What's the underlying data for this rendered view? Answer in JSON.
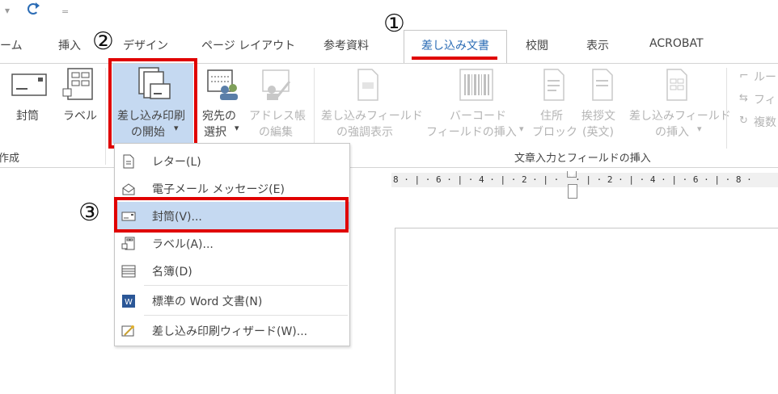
{
  "quick_access": {
    "dropdown_glyph": "▾",
    "customize_glyph": "="
  },
  "tabs": [
    {
      "label": "ホーム"
    },
    {
      "label": "挿入"
    },
    {
      "label": "デザイン"
    },
    {
      "label": "ページ レイアウト"
    },
    {
      "label": "参考資料"
    },
    {
      "label": "差し込み文書",
      "active": true
    },
    {
      "label": "校閲"
    },
    {
      "label": "表示"
    },
    {
      "label": "ACROBAT"
    }
  ],
  "ribbon": {
    "create_group": {
      "label": "作成",
      "envelope_button": "封筒",
      "label_button": "ラベル"
    },
    "start_group": {
      "start_merge_line1": "差し込み印刷",
      "start_merge_line2": "の開始",
      "select_recipients_line1": "宛先の",
      "select_recipients_line2": "選択",
      "edit_list_line1": "アドレス帳",
      "edit_list_line2": "の編集",
      "dropdown_arrow": "▾"
    },
    "fields_group": {
      "label": "文章入力とフィールドの挿入",
      "highlight_fields_line1": "差し込みフィールド",
      "highlight_fields_line2": "の強調表示",
      "barcode_line1": "バーコード",
      "barcode_line2": "フィールドの挿入",
      "address_block_line1": "住所",
      "address_block_line2": "ブロック",
      "greeting_line1": "挨拶文",
      "greeting_line2": "(英文)",
      "insert_field_line1": "差し込みフィールド",
      "insert_field_line2": "の挿入",
      "rules_label": "ルー",
      "match_fields_label": "フィ",
      "update_labels_label": "複数"
    }
  },
  "ruler": {
    "text": "8 · | · 6 · | · 4 · | · 2 · | ·   · | · 2 · | · 4 · | · 6 · | · 8 ·"
  },
  "dropdown_menu": {
    "items": [
      {
        "label": "レター(L)",
        "icon": "letter-icon"
      },
      {
        "label": "電子メール メッセージ(E)",
        "icon": "email-icon"
      },
      {
        "label": "封筒(V)...",
        "icon": "envelope-icon",
        "highlighted": true
      },
      {
        "label": "ラベル(A)...",
        "icon": "labels-icon"
      },
      {
        "label": "名簿(D)",
        "icon": "directory-icon"
      },
      {
        "label": "標準の Word 文書(N)",
        "icon": "word-icon"
      },
      {
        "label": "差し込み印刷ウィザード(W)...",
        "icon": "wizard-icon"
      }
    ]
  },
  "annotations": {
    "marker_1": "①",
    "marker_2": "②",
    "marker_3": "③",
    "highlight_color": "#e00000"
  },
  "colors": {
    "accent_blue": "#2b6cb5",
    "selection_blue": "#c5d9f1",
    "annotation_red": "#e00000"
  }
}
